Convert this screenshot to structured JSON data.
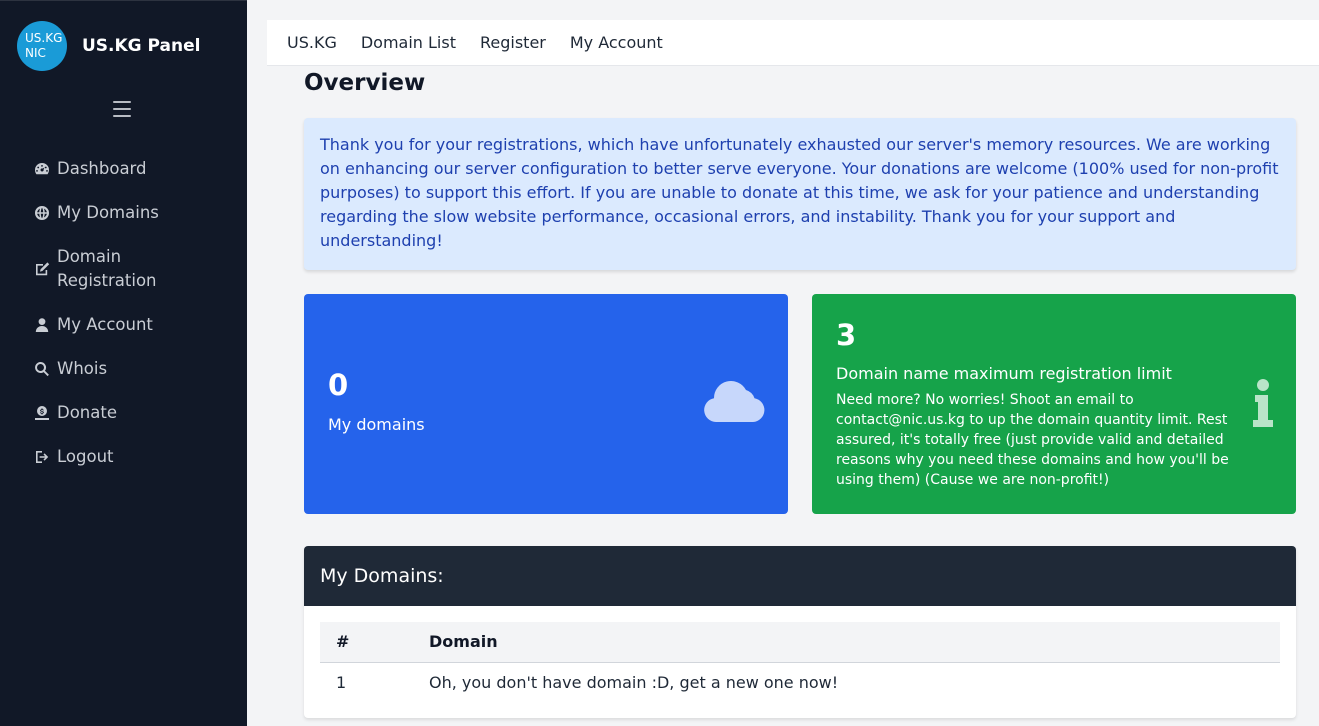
{
  "sidebar": {
    "logo_line1": "US.KG",
    "logo_line2": "NIC",
    "brand": "US.KG Panel",
    "items": [
      {
        "label": "Dashboard",
        "icon": "tachometer-icon"
      },
      {
        "label": "My Domains",
        "icon": "globe-icon"
      },
      {
        "label": "Domain Registration",
        "icon": "edit-icon"
      },
      {
        "label": "My Account",
        "icon": "user-icon"
      },
      {
        "label": "Whois",
        "icon": "search-icon"
      },
      {
        "label": "Donate",
        "icon": "donate-icon"
      },
      {
        "label": "Logout",
        "icon": "logout-icon"
      }
    ]
  },
  "topnav": {
    "items": [
      "US.KG",
      "Domain List",
      "Register",
      "My Account"
    ]
  },
  "main": {
    "title": "Overview",
    "alert": "Thank you for your registrations, which have unfortunately exhausted our server's memory resources. We are working on enhancing our server configuration to better serve everyone. Your donations are welcome (100% used for non-profit purposes) to support this effort. If you are unable to donate at this time, we ask for your patience and understanding regarding the slow website performance, occasional errors, and instability. Thank you for your support and understanding!",
    "card_domains": {
      "count": "0",
      "label": "My domains",
      "icon": "cloud-icon"
    },
    "card_limit": {
      "count": "3",
      "title": "Domain name maximum registration limit",
      "description": "Need more? No worries! Shoot an email to contact@nic.us.kg to up the domain quantity limit. Rest assured, it's totally free (just provide valid and detailed reasons why you need these domains and how you'll be using them) (Cause we are non-profit!)",
      "icon": "info-icon"
    },
    "domains_table": {
      "heading": "My Domains:",
      "columns": [
        "#",
        "Domain"
      ],
      "rows": [
        [
          "1",
          "Oh, you don't have domain :D, get a new one now!"
        ]
      ]
    }
  },
  "colors": {
    "sidebar_bg": "#111827",
    "blue_card": "#2563eb",
    "green_card": "#16a34a",
    "alert_bg": "#dbeafe"
  }
}
